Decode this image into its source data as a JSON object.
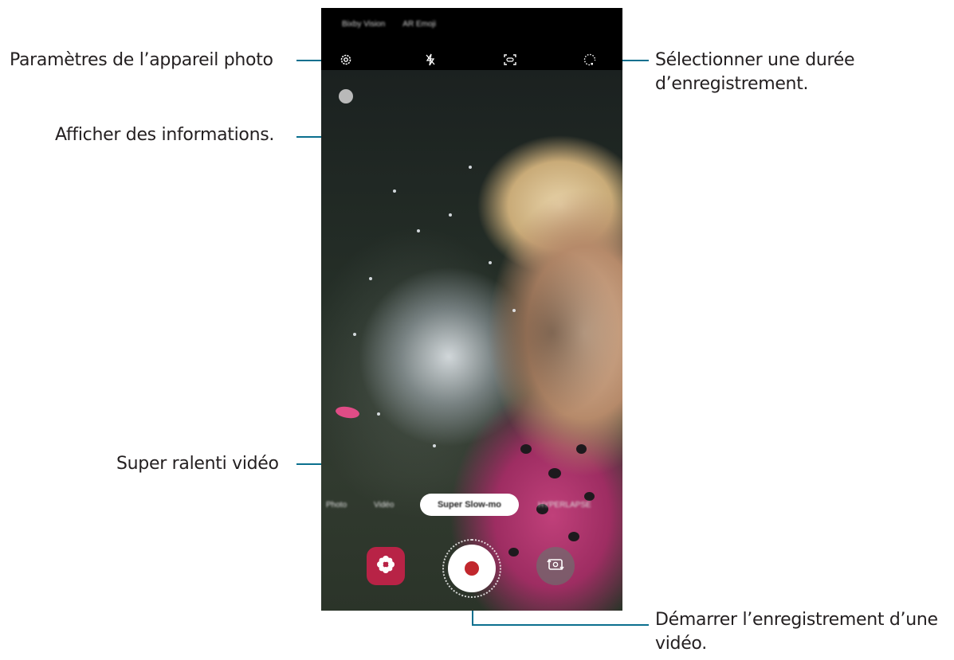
{
  "callouts": {
    "camera_settings": "Paramètres de l’appareil photo",
    "show_info": "Afficher des informations.",
    "select_duration_line1": "Sélectionner une durée",
    "select_duration_line2": "d’enregistrement.",
    "super_slow_mo": "Super ralenti vidéo",
    "start_recording_line1": "Démarrer l’enregistrement d’une",
    "start_recording_line2": "vidéo."
  },
  "phone": {
    "top_tabs": [
      "Bixby Vision",
      "AR Emoji"
    ],
    "top_bar_icons": [
      "gear-icon",
      "flash-off-icon",
      "auto-detect-icon",
      "duration-timer-icon"
    ],
    "modes": [
      "Photo",
      "Vidéo",
      "Super Slow-mo",
      "HYPERLAPSE"
    ],
    "selected_mode": "Super Slow-mo",
    "bottom_icons": [
      "gallery-flower-icon",
      "record-icon",
      "switch-camera-icon"
    ]
  },
  "colors": {
    "callout_line": "#0a6f8e",
    "gallery": "#b82346",
    "record": "#c1272d"
  }
}
